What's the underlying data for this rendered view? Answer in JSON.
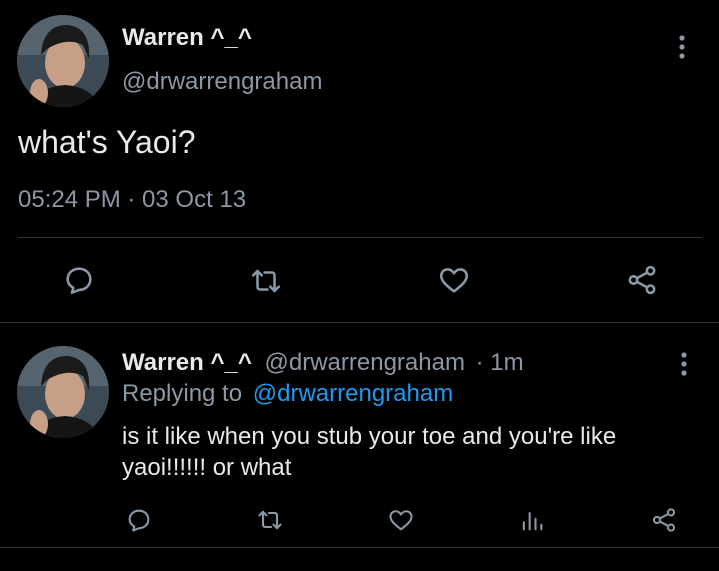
{
  "tweet": {
    "author_name": "Warren ^_^",
    "author_handle": "@drwarrengraham",
    "text": "what's Yaoi?",
    "timestamp": "05:24 PM · 03 Oct 13"
  },
  "reply": {
    "author_name": "Warren ^_^",
    "author_handle": "@drwarrengraham",
    "time_ago": "· 1m",
    "replying_label": "Replying to",
    "replying_handle": "@drwarrengraham",
    "text_line1": "is it like when you stub your toe and you're like",
    "text_line2": "yaoi!!!!!! or what"
  },
  "icons": {
    "more": "more-vertical-icon",
    "reply": "reply-icon",
    "retweet": "retweet-icon",
    "like": "heart-icon",
    "share": "share-icon",
    "analytics": "analytics-icon"
  },
  "colors": {
    "background": "#000000",
    "text": "#e7e9ea",
    "muted": "#8b98a5",
    "link": "#1d9bf0",
    "divider": "#2f3336"
  }
}
